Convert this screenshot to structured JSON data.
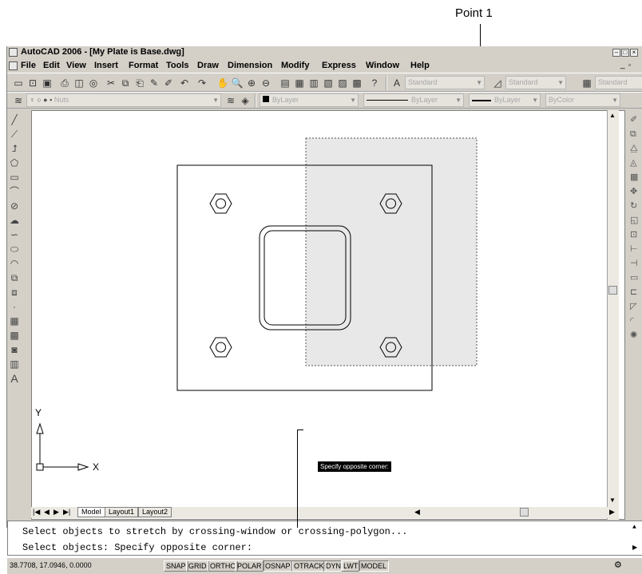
{
  "callout": {
    "point1_label": "Point 1"
  },
  "window": {
    "title": "AutoCAD 2006 - [My Plate is Base.dwg]",
    "menu": [
      "File",
      "Edit",
      "View",
      "Insert",
      "Format",
      "Tools",
      "Draw",
      "Dimension",
      "Modify",
      "Express",
      "Window",
      "Help"
    ]
  },
  "toolbars": {
    "text_style": "Standard",
    "dim_style": "Standard",
    "table_style": "Standard",
    "layer": "Nuts",
    "color": "ByLayer",
    "linetype": "ByLayer",
    "lineweight": "ByLayer",
    "plotstyle": "ByColor"
  },
  "drawing": {
    "tooltip": "Specify opposite corner:",
    "ucs_x": "X",
    "ucs_y": "Y"
  },
  "tabs": [
    "Model",
    "Layout1",
    "Layout2"
  ],
  "command_line": {
    "line1": "Select objects to stretch by crossing-window or crossing-polygon...",
    "line2": "Select objects: Specify opposite corner:"
  },
  "status": {
    "coords": "38.7708, 17.0946, 0.0000",
    "buttons": [
      "SNAP",
      "GRID",
      "ORTHO",
      "POLAR",
      "OSNAP",
      "OTRACK",
      "DYN",
      "LWT",
      "MODEL"
    ]
  },
  "colors": {
    "selection_fill": "#e8e8e8",
    "window_bg": "#d4d0c8"
  }
}
